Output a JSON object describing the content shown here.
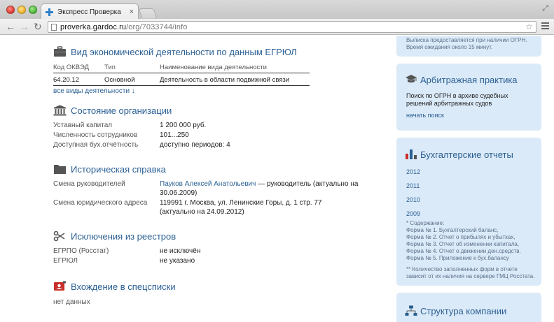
{
  "browser": {
    "tab_title": "Экспресс Проверка",
    "url_host": "proverka.gardoc.ru",
    "url_path": "/org/7033744/info"
  },
  "main": {
    "okved": {
      "title": "Вид экономической деятельности по данным ЕГРЮЛ",
      "headers": [
        "Код ОКВЭД",
        "Тип",
        "Наименование вида деятельности"
      ],
      "row": [
        "64.20.12",
        "Основной",
        "Деятельность в области подвижной связи"
      ],
      "all_link": "все виды деятельности ↓"
    },
    "state": {
      "title": "Состояние организации",
      "rows": [
        {
          "k": "Уставный капитал",
          "v": "1 200 000 руб."
        },
        {
          "k": "Численность сотрудников",
          "v": "101...250"
        },
        {
          "k": "Доступная бух.отчётность",
          "v": "доступно периодов: 4"
        }
      ]
    },
    "history": {
      "title": "Историческая справка",
      "leaders_label": "Смена руководителей",
      "leader_name": "Пауков Алексей Анатольевич",
      "leader_text": " — руководитель (актуально на",
      "leader_date": "30.06.2009)",
      "address_label": "Смена юридического адреса",
      "address_line1": "119991 г. Москва, ул. Ленинские Горы, д. 1 стр. 77",
      "address_line2": "(актуально на 24.09.2012)"
    },
    "exclusions": {
      "title": "Исключения из реестров",
      "rows": [
        {
          "k": "ЕГРПО (Росстат)",
          "v": "не исключён"
        },
        {
          "k": "ЕГРЮЛ",
          "v": "не указано"
        }
      ]
    },
    "speclists": {
      "title": "Вхождение в спецсписки",
      "value": "нет данных"
    }
  },
  "sidebar": {
    "top_card": {
      "line1": "Выписка предоставляется при наличии ОГРН.",
      "line2": "Время ожидания около 15 минут."
    },
    "arbitration": {
      "title": "Арбитражная практика",
      "line1": "Поиск по ОГРН в архиве судебных",
      "line2": "решений арбитражных судов",
      "link": "начать поиск"
    },
    "reports": {
      "title": "Бухгалтерские отчеты",
      "years": [
        "2012",
        "2011",
        "2010",
        "2009"
      ],
      "notes": [
        "* Содержание:",
        "Форма № 1. Бухгалтерский баланс,",
        "Форма № 2. Отчет о прибылях и убытках,",
        "Форма № 3. Отчет об изменении капитала,",
        "Форма № 4. Отчет о движении ден.средств,",
        "Форма № 5. Приложение к бух.балансу"
      ],
      "footnote1": "** Количество заполненных форм в отчете",
      "footnote2": "зависит от их наличия на сервере ГМЦ Росстата."
    },
    "structure": {
      "title": "Структура компании"
    }
  },
  "colors": {
    "accent": "#2a5f93",
    "card_bg": "#dbeaf8"
  }
}
